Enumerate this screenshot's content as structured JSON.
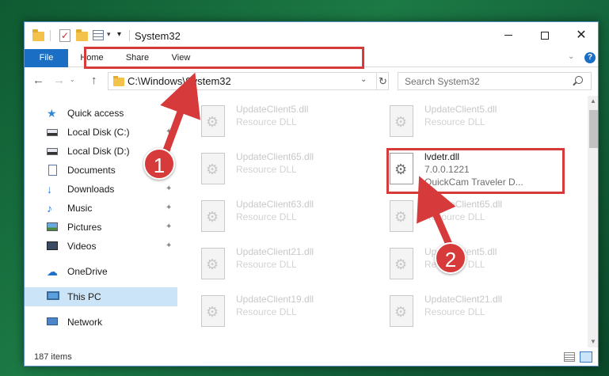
{
  "window": {
    "title": "System32",
    "title_dropdown": "▾",
    "minimize_label": "",
    "maximize_label": "",
    "close_label": "✕"
  },
  "ribbon": {
    "tabs": [
      "File",
      "Home",
      "Share",
      "View"
    ],
    "expand_label": "⌄",
    "help_label": "?"
  },
  "nav": {
    "back_label": "←",
    "forward_label": "→",
    "history_label": "⌄",
    "up_label": "↑",
    "address": "C:\\Windows\\System32",
    "address_dropdown": "⌄",
    "refresh_label": "↻",
    "search_placeholder": "Search System32"
  },
  "sidebar": {
    "items": [
      {
        "label": "Quick access",
        "icon": "star-icon"
      },
      {
        "label": "Local Disk (C:)",
        "icon": "drive-icon",
        "pinned": true
      },
      {
        "label": "Local Disk (D:)",
        "icon": "drive-icon",
        "pinned": true
      },
      {
        "label": "Documents",
        "icon": "documents-icon",
        "pinned": true
      },
      {
        "label": "Downloads",
        "icon": "download-icon",
        "pinned": true
      },
      {
        "label": "Music",
        "icon": "music-icon",
        "pinned": true
      },
      {
        "label": "Pictures",
        "icon": "pictures-icon",
        "pinned": true
      },
      {
        "label": "Videos",
        "icon": "videos-icon",
        "pinned": true
      },
      {
        "label": "OneDrive",
        "icon": "cloud-icon"
      },
      {
        "label": "This PC",
        "icon": "computer-icon",
        "selected": true
      },
      {
        "label": "Network",
        "icon": "network-icon"
      }
    ]
  },
  "files": [
    {
      "name": "UpdateClient5.dll",
      "type": "Resource DLL"
    },
    {
      "name": "UpdateClient5.dll",
      "type": "Resource DLL"
    },
    {
      "name": "UpdateClient65.dll",
      "type": "Resource DLL"
    },
    {
      "name": "lvdetr.dll",
      "version": "7.0.0.1221",
      "description": "QuickCam Traveler D...",
      "highlighted": true
    },
    {
      "name": "UpdateClient63.dll",
      "type": "Resource DLL"
    },
    {
      "name": "UpdateClient65.dll",
      "type": "Resource DLL"
    },
    {
      "name": "UpdateClient21.dll",
      "type": "Resource DLL"
    },
    {
      "name": "UpdateClient5.dll",
      "type": "Resource DLL"
    },
    {
      "name": "UpdateClient19.dll",
      "type": "Resource DLL"
    },
    {
      "name": "UpdateClient21.dll",
      "type": "Resource DLL"
    }
  ],
  "status": {
    "item_count": "187 items"
  },
  "annotations": {
    "badge_1": "1",
    "badge_2": "2",
    "color": "#d63a3a"
  },
  "pin_glyph": "📌"
}
